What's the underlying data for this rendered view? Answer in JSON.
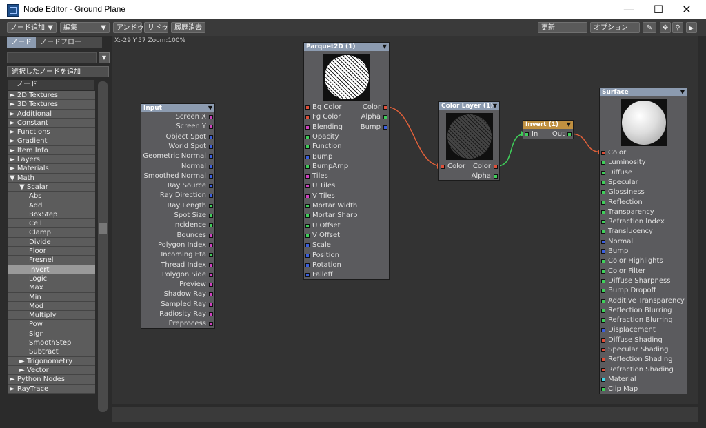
{
  "window": {
    "title": "Node Editor - Ground Plane",
    "minimize": "—",
    "maximize": "☐",
    "close": "✕"
  },
  "toolbar": {
    "add_node": "ノード追加",
    "edit": "編集",
    "undo": "アンドゥ",
    "redo": "リドゥ",
    "clear_history": "履歴消去",
    "update": "更新",
    "options": "オプション",
    "dropdown_arrow": "▼",
    "play_arrow": "▶",
    "pen": "✎",
    "move": "✥",
    "zoom": "⚲"
  },
  "sidebar": {
    "tab_nodes": "ノード",
    "tab_nodeflow": "ノードフロー",
    "add_selected": "選択したノードを追加",
    "list_header": "ノード",
    "search_dropdown": "▼",
    "items": [
      {
        "label": "► 2D Textures",
        "level": 0
      },
      {
        "label": "► 3D Textures",
        "level": 0
      },
      {
        "label": "► Additional",
        "level": 0
      },
      {
        "label": "► Constant",
        "level": 0
      },
      {
        "label": "► Functions",
        "level": 0
      },
      {
        "label": "► Gradient",
        "level": 0
      },
      {
        "label": "► Item Info",
        "level": 0
      },
      {
        "label": "► Layers",
        "level": 0
      },
      {
        "label": "► Materials",
        "level": 0
      },
      {
        "label": "▼ Math",
        "level": 0
      },
      {
        "label": "▼ Scalar",
        "level": 1
      },
      {
        "label": "Abs",
        "level": 2
      },
      {
        "label": "Add",
        "level": 2
      },
      {
        "label": "BoxStep",
        "level": 2
      },
      {
        "label": "Ceil",
        "level": 2
      },
      {
        "label": "Clamp",
        "level": 2
      },
      {
        "label": "Divide",
        "level": 2
      },
      {
        "label": "Floor",
        "level": 2
      },
      {
        "label": "Fresnel",
        "level": 2
      },
      {
        "label": "Invert",
        "level": 2,
        "selected": true
      },
      {
        "label": "Logic",
        "level": 2
      },
      {
        "label": "Max",
        "level": 2
      },
      {
        "label": "Min",
        "level": 2
      },
      {
        "label": "Mod",
        "level": 2
      },
      {
        "label": "Multiply",
        "level": 2
      },
      {
        "label": "Pow",
        "level": 2
      },
      {
        "label": "Sign",
        "level": 2
      },
      {
        "label": "SmoothStep",
        "level": 2
      },
      {
        "label": "Subtract",
        "level": 2
      },
      {
        "label": "► Trigonometry",
        "level": 1
      },
      {
        "label": "► Vector",
        "level": 1
      },
      {
        "label": "► Python Nodes",
        "level": 0
      },
      {
        "label": "► RayTrace",
        "level": 0
      }
    ]
  },
  "canvas": {
    "coords": "X:-29 Y:57 Zoom:100%"
  },
  "colors": {
    "port_red": "#e0503a",
    "port_green": "#3fcf5a",
    "port_blue": "#3a5fe0",
    "port_magenta": "#d040c0",
    "port_cyan": "#40d8e8",
    "wire_red": "#e0603a",
    "wire_green": "#3fcf5a",
    "header_default": "#8c9bb0",
    "header_invert": "#c09040"
  },
  "nodes": {
    "input": {
      "title": "Input",
      "menu": "▼",
      "outputs": [
        {
          "label": "Screen X",
          "color": "magenta"
        },
        {
          "label": "Screen Y",
          "color": "magenta"
        },
        {
          "label": "Object Spot",
          "color": "blue"
        },
        {
          "label": "World Spot",
          "color": "blue"
        },
        {
          "label": "Geometric Normal",
          "color": "blue"
        },
        {
          "label": "Normal",
          "color": "blue"
        },
        {
          "label": "Smoothed Normal",
          "color": "blue"
        },
        {
          "label": "Ray Source",
          "color": "blue"
        },
        {
          "label": "Ray Direction",
          "color": "blue"
        },
        {
          "label": "Ray Length",
          "color": "green"
        },
        {
          "label": "Spot Size",
          "color": "green"
        },
        {
          "label": "Incidence",
          "color": "green"
        },
        {
          "label": "Bounces",
          "color": "magenta"
        },
        {
          "label": "Polygon Index",
          "color": "magenta"
        },
        {
          "label": "Incoming Eta",
          "color": "green"
        },
        {
          "label": "Thread Index",
          "color": "magenta"
        },
        {
          "label": "Polygon Side",
          "color": "magenta"
        },
        {
          "label": "Preview",
          "color": "magenta"
        },
        {
          "label": "Shadow Ray",
          "color": "magenta"
        },
        {
          "label": "Sampled Ray",
          "color": "magenta"
        },
        {
          "label": "Radiosity Ray",
          "color": "magenta"
        },
        {
          "label": "Preprocess",
          "color": "magenta"
        }
      ]
    },
    "parquet": {
      "title": "Parquet2D (1)",
      "menu": "▼",
      "inputs": [
        {
          "label": "Bg Color",
          "color": "red"
        },
        {
          "label": "Fg Color",
          "color": "red"
        },
        {
          "label": "Blending",
          "color": "magenta"
        },
        {
          "label": "Opacity",
          "color": "green"
        },
        {
          "label": "Function",
          "color": "green"
        },
        {
          "label": "Bump",
          "color": "blue"
        },
        {
          "label": "BumpAmp",
          "color": "green"
        },
        {
          "label": "Tiles",
          "color": "magenta"
        },
        {
          "label": "U Tiles",
          "color": "magenta"
        },
        {
          "label": "V Tiles",
          "color": "magenta"
        },
        {
          "label": "Mortar Width",
          "color": "green"
        },
        {
          "label": "Mortar Sharp",
          "color": "green"
        },
        {
          "label": "U Offset",
          "color": "green"
        },
        {
          "label": "V Offset",
          "color": "green"
        },
        {
          "label": "Scale",
          "color": "blue"
        },
        {
          "label": "Position",
          "color": "blue"
        },
        {
          "label": "Rotation",
          "color": "blue"
        },
        {
          "label": "Falloff",
          "color": "blue"
        }
      ],
      "outputs": [
        {
          "label": "Color",
          "color": "red"
        },
        {
          "label": "Alpha",
          "color": "green"
        },
        {
          "label": "Bump",
          "color": "blue"
        }
      ]
    },
    "colorlayer": {
      "title": "Color Layer (1)",
      "menu": "▼",
      "inputs": [
        {
          "label": "Color",
          "color": "red"
        }
      ],
      "outputs": [
        {
          "label": "Color",
          "color": "red"
        },
        {
          "label": "Alpha",
          "color": "green"
        }
      ]
    },
    "invert": {
      "title": "Invert (1)",
      "menu": "▼",
      "inputs": [
        {
          "label": "In",
          "color": "green"
        }
      ],
      "outputs": [
        {
          "label": "Out",
          "color": "green"
        }
      ]
    },
    "surface": {
      "title": "Surface",
      "menu": "▼",
      "inputs": [
        {
          "label": "Color",
          "color": "red"
        },
        {
          "label": "Luminosity",
          "color": "green"
        },
        {
          "label": "Diffuse",
          "color": "green"
        },
        {
          "label": "Specular",
          "color": "green"
        },
        {
          "label": "Glossiness",
          "color": "green"
        },
        {
          "label": "Reflection",
          "color": "green"
        },
        {
          "label": "Transparency",
          "color": "green"
        },
        {
          "label": "Refraction Index",
          "color": "green"
        },
        {
          "label": "Translucency",
          "color": "green"
        },
        {
          "label": "Normal",
          "color": "blue"
        },
        {
          "label": "Bump",
          "color": "blue"
        },
        {
          "label": "Color Highlights",
          "color": "green"
        },
        {
          "label": "Color Filter",
          "color": "green"
        },
        {
          "label": "Diffuse Sharpness",
          "color": "green"
        },
        {
          "label": "Bump Dropoff",
          "color": "green"
        },
        {
          "label": "Additive Transparency",
          "color": "green"
        },
        {
          "label": "Reflection Blurring",
          "color": "green"
        },
        {
          "label": "Refraction Blurring",
          "color": "green"
        },
        {
          "label": "Displacement",
          "color": "blue"
        },
        {
          "label": "Diffuse Shading",
          "color": "red"
        },
        {
          "label": "Specular Shading",
          "color": "red"
        },
        {
          "label": "Reflection Shading",
          "color": "red"
        },
        {
          "label": "Refraction Shading",
          "color": "red"
        },
        {
          "label": "Material",
          "color": "cyan"
        },
        {
          "label": "Clip Map",
          "color": "green"
        }
      ]
    }
  }
}
